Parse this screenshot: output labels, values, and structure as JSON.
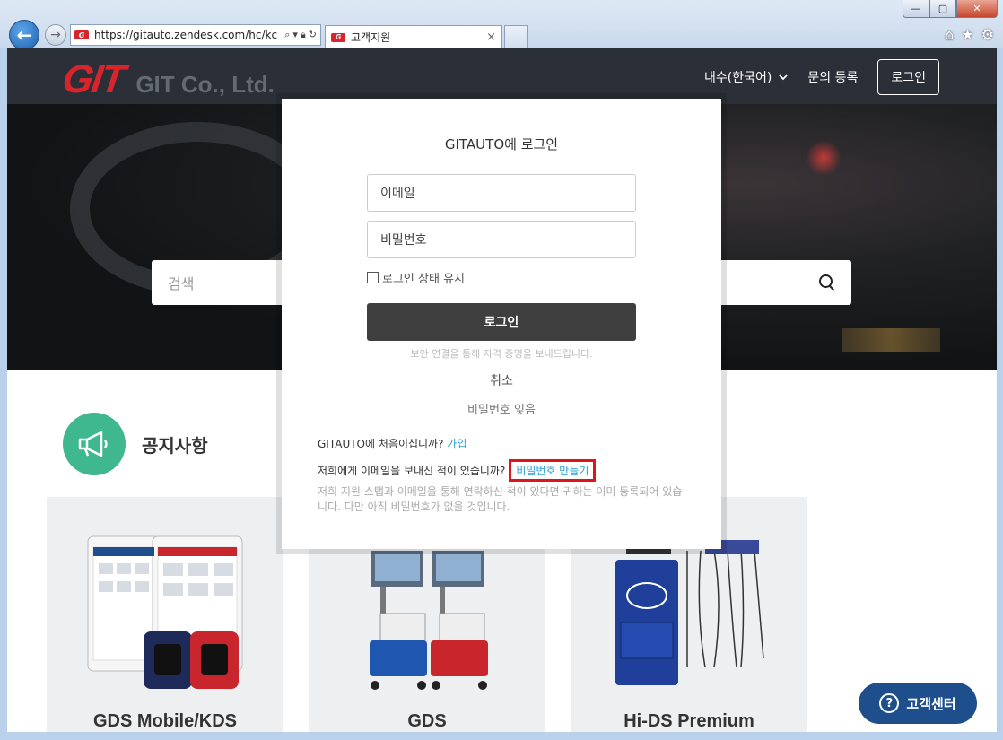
{
  "browser": {
    "url": "https://gitauto.zendesk.com/hc/kc",
    "tab_title": "고객지원",
    "tab_close": "×",
    "back_glyph": "←",
    "forward_glyph": "→",
    "window_minimize": "—",
    "window_maximize": "▢",
    "window_close": "✕",
    "icons": [
      "home-icon",
      "star-icon",
      "gear-icon"
    ]
  },
  "site": {
    "logo_text": "GIT",
    "company_name": "GIT Co., Ltd.",
    "nav": {
      "language": "내수(한국어)",
      "submit_request": "문의 등록",
      "login": "로그인"
    },
    "search_placeholder": "검색",
    "notice_title": "공지사항",
    "products": [
      {
        "label": "GDS Mobile/KDS"
      },
      {
        "label": "GDS"
      },
      {
        "label": "Hi-DS Premium"
      }
    ],
    "help_button": "고객센터",
    "help_glyph": "?"
  },
  "modal": {
    "title": "GITAUTO에 로그인",
    "email_placeholder": "이메일",
    "password_placeholder": "비밀번호",
    "remember_me": "로그인 상태 유지",
    "submit": "로그인",
    "secure_note": "보안 연결을 통해 자격 증명을 보내드립니다.",
    "cancel": "취소",
    "forgot_password": "비밀번호 잊음",
    "first_time_text": "GITAUTO에 처음이십니까?",
    "signup_link": "가입",
    "emailed_text": "저희에게 이메일을 보내신 적이 있습니까?",
    "create_password_link": "비밀번호 만들기",
    "hint": "저희 지원 스탭과 이메일을 통해 연락하신 적이 있다면 귀하는 이미 등록되어 있습니다. 다만 아직 비밀번호가 없을 것입니다."
  },
  "colors": {
    "brand_red": "#d8252b",
    "header_bg": "#2b3038",
    "notice_green": "#3fb88f",
    "help_blue": "#1e4f8c",
    "link_blue": "#2a9fd8",
    "highlight_red": "#e0141e"
  }
}
